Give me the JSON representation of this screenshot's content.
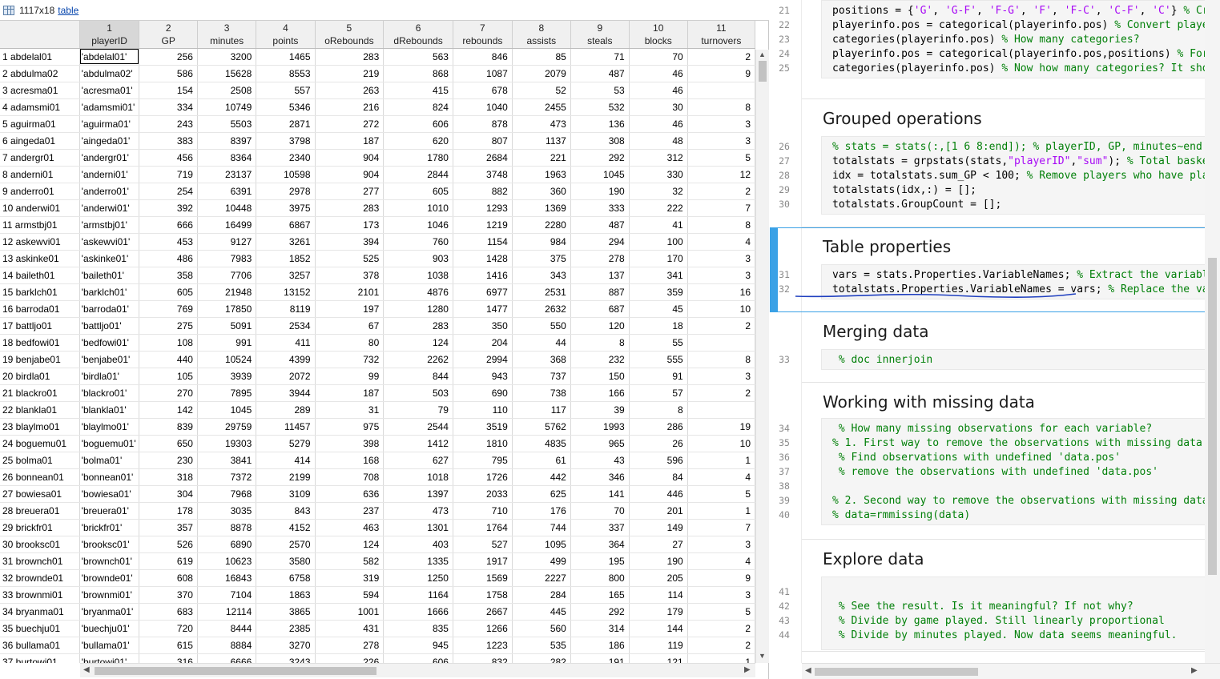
{
  "variable_editor": {
    "dims": "1117x18",
    "class_link": "table",
    "columns": [
      {
        "num": "",
        "name": ""
      },
      {
        "num": "1",
        "name": "playerID"
      },
      {
        "num": "2",
        "name": "GP"
      },
      {
        "num": "3",
        "name": "minutes"
      },
      {
        "num": "4",
        "name": "points"
      },
      {
        "num": "5",
        "name": "oRebounds"
      },
      {
        "num": "6",
        "name": "dRebounds"
      },
      {
        "num": "7",
        "name": "rebounds"
      },
      {
        "num": "8",
        "name": "assists"
      },
      {
        "num": "9",
        "name": "steals"
      },
      {
        "num": "10",
        "name": "blocks"
      },
      {
        "num": "11",
        "name": "turnovers"
      }
    ],
    "rows": [
      [
        "1 abdelal01",
        "'abdelal01'",
        "256",
        "3200",
        "1465",
        "283",
        "563",
        "846",
        "85",
        "71",
        "70",
        "2"
      ],
      [
        "2 abdulma02",
        "'abdulma02'",
        "586",
        "15628",
        "8553",
        "219",
        "868",
        "1087",
        "2079",
        "487",
        "46",
        "9"
      ],
      [
        "3 acresma01",
        "'acresma01'",
        "154",
        "2508",
        "557",
        "263",
        "415",
        "678",
        "52",
        "53",
        "46",
        ""
      ],
      [
        "4 adamsmi01",
        "'adamsmi01'",
        "334",
        "10749",
        "5346",
        "216",
        "824",
        "1040",
        "2455",
        "532",
        "30",
        "8"
      ],
      [
        "5 aguirma01",
        "'aguirma01'",
        "243",
        "5503",
        "2871",
        "272",
        "606",
        "878",
        "473",
        "136",
        "46",
        "3"
      ],
      [
        "6 aingeda01",
        "'aingeda01'",
        "383",
        "8397",
        "3798",
        "187",
        "620",
        "807",
        "1137",
        "308",
        "48",
        "3"
      ],
      [
        "7 andergr01",
        "'andergr01'",
        "456",
        "8364",
        "2340",
        "904",
        "1780",
        "2684",
        "221",
        "292",
        "312",
        "5"
      ],
      [
        "8 anderni01",
        "'anderni01'",
        "719",
        "23137",
        "10598",
        "904",
        "2844",
        "3748",
        "1963",
        "1045",
        "330",
        "12"
      ],
      [
        "9 anderro01",
        "'anderro01'",
        "254",
        "6391",
        "2978",
        "277",
        "605",
        "882",
        "360",
        "190",
        "32",
        "2"
      ],
      [
        "10 anderwi01",
        "'anderwi01'",
        "392",
        "10448",
        "3975",
        "283",
        "1010",
        "1293",
        "1369",
        "333",
        "222",
        "7"
      ],
      [
        "11 armstbj01",
        "'armstbj01'",
        "666",
        "16499",
        "6867",
        "173",
        "1046",
        "1219",
        "2280",
        "487",
        "41",
        "8"
      ],
      [
        "12 askewvi01",
        "'askewvi01'",
        "453",
        "9127",
        "3261",
        "394",
        "760",
        "1154",
        "984",
        "294",
        "100",
        "4"
      ],
      [
        "13 askinke01",
        "'askinke01'",
        "486",
        "7983",
        "1852",
        "525",
        "903",
        "1428",
        "375",
        "278",
        "170",
        "3"
      ],
      [
        "14 bailеth01",
        "'baileth01'",
        "358",
        "7706",
        "3257",
        "378",
        "1038",
        "1416",
        "343",
        "137",
        "341",
        "3"
      ],
      [
        "15 barklch01",
        "'barklch01'",
        "605",
        "21948",
        "13152",
        "2101",
        "4876",
        "6977",
        "2531",
        "887",
        "359",
        "16"
      ],
      [
        "16 barroda01",
        "'barroda01'",
        "769",
        "17850",
        "8119",
        "197",
        "1280",
        "1477",
        "2632",
        "687",
        "45",
        "10"
      ],
      [
        "17 battljo01",
        "'battljo01'",
        "275",
        "5091",
        "2534",
        "67",
        "283",
        "350",
        "550",
        "120",
        "18",
        "2"
      ],
      [
        "18 bedfowi01",
        "'bedfowi01'",
        "108",
        "991",
        "411",
        "80",
        "124",
        "204",
        "44",
        "8",
        "55",
        ""
      ],
      [
        "19 benjabe01",
        "'benjabe01'",
        "440",
        "10524",
        "4399",
        "732",
        "2262",
        "2994",
        "368",
        "232",
        "555",
        "8"
      ],
      [
        "20 birdla01",
        "'birdla01'",
        "105",
        "3939",
        "2072",
        "99",
        "844",
        "943",
        "737",
        "150",
        "91",
        "3"
      ],
      [
        "21 blackro01",
        "'blackro01'",
        "270",
        "7895",
        "3944",
        "187",
        "503",
        "690",
        "738",
        "166",
        "57",
        "2"
      ],
      [
        "22 blankla01",
        "'blankla01'",
        "142",
        "1045",
        "289",
        "31",
        "79",
        "110",
        "117",
        "39",
        "8",
        ""
      ],
      [
        "23 blaylmo01",
        "'blaylmo01'",
        "839",
        "29759",
        "11457",
        "975",
        "2544",
        "3519",
        "5762",
        "1993",
        "286",
        "19"
      ],
      [
        "24 boguemu01",
        "'boguemu01'",
        "650",
        "19303",
        "5279",
        "398",
        "1412",
        "1810",
        "4835",
        "965",
        "26",
        "10"
      ],
      [
        "25 bolma01",
        "'bolma01'",
        "230",
        "3841",
        "414",
        "168",
        "627",
        "795",
        "61",
        "43",
        "596",
        "1"
      ],
      [
        "26 bonnean01",
        "'bonnean01'",
        "318",
        "7372",
        "2199",
        "708",
        "1018",
        "1726",
        "442",
        "346",
        "84",
        "4"
      ],
      [
        "27 bowiesa01",
        "'bowiesa01'",
        "304",
        "7968",
        "3109",
        "636",
        "1397",
        "2033",
        "625",
        "141",
        "446",
        "5"
      ],
      [
        "28 breuera01",
        "'breuera01'",
        "178",
        "3035",
        "843",
        "237",
        "473",
        "710",
        "176",
        "70",
        "201",
        "1"
      ],
      [
        "29 brickfr01",
        "'brickfr01'",
        "357",
        "8878",
        "4152",
        "463",
        "1301",
        "1764",
        "744",
        "337",
        "149",
        "7"
      ],
      [
        "30 brooksc01",
        "'brooksc01'",
        "526",
        "6890",
        "2570",
        "124",
        "403",
        "527",
        "1095",
        "364",
        "27",
        "3"
      ],
      [
        "31 brownch01",
        "'brownch01'",
        "619",
        "10623",
        "3580",
        "582",
        "1335",
        "1917",
        "499",
        "195",
        "190",
        "4"
      ],
      [
        "32 brownde01",
        "'brownde01'",
        "608",
        "16843",
        "6758",
        "319",
        "1250",
        "1569",
        "2227",
        "800",
        "205",
        "9"
      ],
      [
        "33 brownmi01",
        "'brownmi01'",
        "370",
        "7104",
        "1863",
        "594",
        "1164",
        "1758",
        "284",
        "165",
        "114",
        "3"
      ],
      [
        "34 bryanma01",
        "'bryanma01'",
        "683",
        "12114",
        "3865",
        "1001",
        "1666",
        "2667",
        "445",
        "292",
        "179",
        "5"
      ],
      [
        "35 buechju01",
        "'buechju01'",
        "720",
        "8444",
        "2385",
        "431",
        "835",
        "1266",
        "560",
        "314",
        "144",
        "2"
      ],
      [
        "36 bullama01",
        "'bullama01'",
        "615",
        "8884",
        "3270",
        "278",
        "945",
        "1223",
        "535",
        "186",
        "119",
        "2"
      ],
      [
        "37 burtowi01",
        "'burtowi01'",
        "316",
        "6666",
        "3243",
        "226",
        "606",
        "832",
        "282",
        "191",
        "121",
        "1"
      ]
    ]
  },
  "editor": {
    "sections": [
      {
        "lines": [
          {
            "n": "21",
            "parts": [
              [
                "c",
                "positions = {"
              ],
              [
                "s",
                "'G'"
              ],
              [
                "c",
                ", "
              ],
              [
                "s",
                "'G-F'"
              ],
              [
                "c",
                ", "
              ],
              [
                "s",
                "'F-G'"
              ],
              [
                "c",
                ", "
              ],
              [
                "s",
                "'F'"
              ],
              [
                "c",
                ", "
              ],
              [
                "s",
                "'F-C'"
              ],
              [
                "c",
                ", "
              ],
              [
                "s",
                "'C-F'"
              ],
              [
                "c",
                ", "
              ],
              [
                "s",
                "'C'"
              ],
              [
                "c",
                "} "
              ],
              [
                "m",
                "% Cr"
              ]
            ]
          },
          {
            "n": "22",
            "parts": [
              [
                "c",
                "playerinfo.pos = categorical(playerinfo.pos) "
              ],
              [
                "m",
                "% Convert playe"
              ]
            ]
          },
          {
            "n": "23",
            "parts": [
              [
                "c",
                "categories(playerinfo.pos) "
              ],
              [
                "m",
                "% How many categories?"
              ]
            ]
          },
          {
            "n": "24",
            "parts": [
              [
                "c",
                "playerinfo.pos = categorical(playerinfo.pos,positions) "
              ],
              [
                "m",
                "% For"
              ]
            ]
          },
          {
            "n": "25",
            "parts": [
              [
                "c",
                "categories(playerinfo.pos) "
              ],
              [
                "m",
                "% Now how many categories? It sho"
              ]
            ]
          }
        ]
      },
      {
        "heading": "Grouped operations",
        "lines": [
          {
            "n": "26",
            "parts": [
              [
                "m",
                "% stats = stats(:,[1 6 8:end]); % playerID, GP, minutes~end"
              ]
            ]
          },
          {
            "n": "27",
            "parts": [
              [
                "c",
                "totalstats = grpstats(stats,"
              ],
              [
                "s",
                "\"playerID\""
              ],
              [
                "c",
                ","
              ],
              [
                "s",
                "\"sum\""
              ],
              [
                "c",
                "); "
              ],
              [
                "m",
                "% Total baske"
              ]
            ]
          },
          {
            "n": "28",
            "parts": [
              [
                "c",
                "idx = totalstats.sum_GP < 100; "
              ],
              [
                "m",
                "% Remove players who have pla"
              ]
            ]
          },
          {
            "n": "29",
            "parts": [
              [
                "c",
                "totalstats(idx,:) = [];"
              ]
            ]
          },
          {
            "n": "30",
            "parts": [
              [
                "c",
                "totalstats.GroupCount = [];"
              ]
            ]
          }
        ]
      },
      {
        "heading": "Table properties",
        "lines": [
          {
            "n": "31",
            "parts": [
              [
                "c",
                "vars = stats.Properties.VariableNames; "
              ],
              [
                "m",
                "% Extract the variabl"
              ]
            ]
          },
          {
            "n": "32",
            "parts": [
              [
                "c",
                "totalstats.Properties.VariableNames = vars; "
              ],
              [
                "m",
                "% Replace the va"
              ]
            ]
          }
        ]
      },
      {
        "heading": "Merging data",
        "lines": [
          {
            "n": "33",
            "parts": [
              [
                "m",
                " % doc innerjoin"
              ]
            ]
          }
        ]
      },
      {
        "heading": "Working with missing data",
        "lines": [
          {
            "n": "34",
            "parts": [
              [
                "m",
                " % How many missing observations for each variable?"
              ]
            ]
          },
          {
            "n": "35",
            "parts": [
              [
                "m",
                "% 1. First way to remove the observations with missing data"
              ]
            ]
          },
          {
            "n": "36",
            "parts": [
              [
                "m",
                " % Find observations with undefined 'data.pos'"
              ]
            ]
          },
          {
            "n": "37",
            "parts": [
              [
                "m",
                " % remove the observations with undefined 'data.pos'"
              ]
            ]
          },
          {
            "n": "38",
            "parts": [
              [
                "c",
                ""
              ]
            ]
          },
          {
            "n": "39",
            "parts": [
              [
                "m",
                "% 2. Second way to remove the observations with missing data"
              ]
            ]
          },
          {
            "n": "40",
            "parts": [
              [
                "m",
                "% data=rmmissing(data)"
              ]
            ]
          }
        ]
      },
      {
        "heading": "Explore data",
        "lines": [
          {
            "n": "41",
            "parts": [
              [
                "c",
                ""
              ]
            ]
          },
          {
            "n": "42",
            "parts": [
              [
                "m",
                " % See the result. Is it meaningful? If not why?"
              ]
            ]
          },
          {
            "n": "43",
            "parts": [
              [
                "m",
                " % Divide by game played. Still linearly proportional"
              ]
            ]
          },
          {
            "n": "44",
            "parts": [
              [
                "m",
                " % Divide by minutes played. Now data seems meaningful."
              ]
            ]
          }
        ]
      }
    ]
  }
}
